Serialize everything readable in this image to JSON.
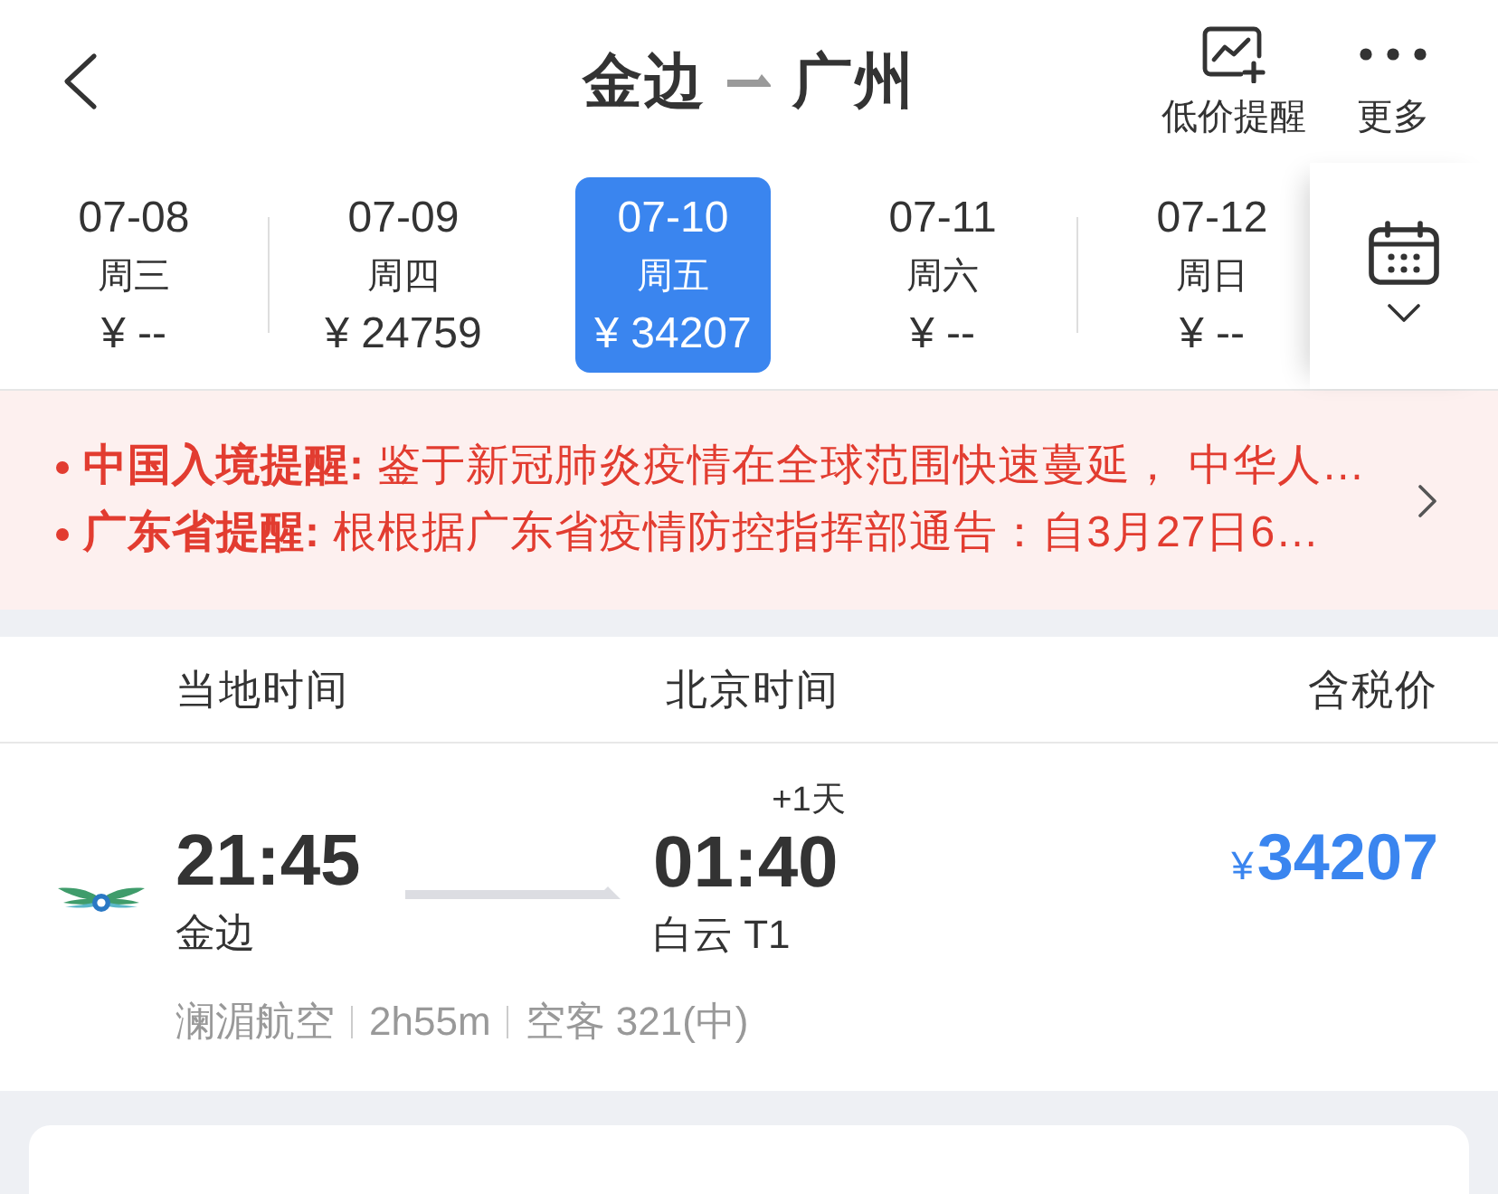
{
  "header": {
    "origin": "金边",
    "destination": "广州",
    "actions": [
      {
        "kind": "price_alert",
        "label": "低价提醒"
      },
      {
        "kind": "more",
        "label": "更多"
      }
    ]
  },
  "dates": [
    {
      "date": "07-08",
      "weekday": "周三",
      "price": "¥ --",
      "selected": false
    },
    {
      "date": "07-09",
      "weekday": "周四",
      "price": "¥ 24759",
      "selected": false
    },
    {
      "date": "07-10",
      "weekday": "周五",
      "price": "¥ 34207",
      "selected": true
    },
    {
      "date": "07-11",
      "weekday": "周六",
      "price": "¥ --",
      "selected": false
    },
    {
      "date": "07-12",
      "weekday": "周日",
      "price": "¥ --",
      "selected": false
    }
  ],
  "notices": [
    "**中国入境提醒:** 鉴于新冠肺炎疫情在全球范围快速蔓延， 中华人…",
    "**广东省提醒:** 根根据广东省疫情防控指挥部通告：自3月27日6…"
  ],
  "columns": [
    "当地时间",
    "北京时间",
    "含税价"
  ],
  "flight": {
    "departure": {
      "time": "21:45",
      "airport": "金边"
    },
    "arrival": {
      "time": "01:40",
      "day_offset": "+1天",
      "airport": "白云 T1"
    },
    "price": {
      "currency": "¥",
      "amount": "34207"
    },
    "details": [
      "澜湄航空",
      "2h55m",
      "空客 321(中)"
    ]
  }
}
